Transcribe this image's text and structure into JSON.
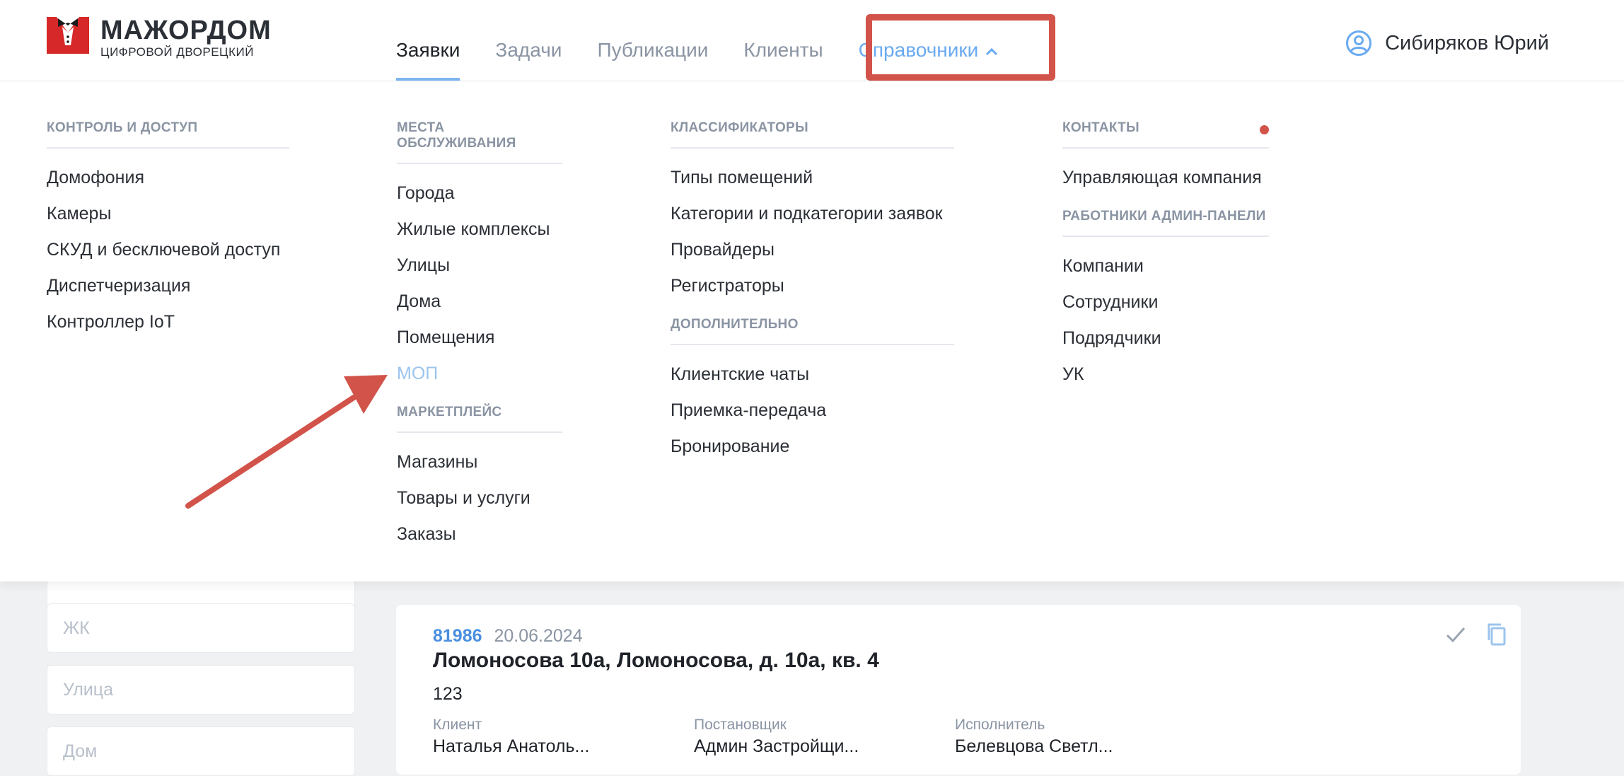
{
  "header": {
    "logo_title": "МАЖОРДОМ",
    "logo_subtitle": "ЦИФРОВОЙ ДВОРЕЦКИЙ",
    "nav": [
      {
        "label": "Заявки",
        "state": "active"
      },
      {
        "label": "Задачи",
        "state": "normal"
      },
      {
        "label": "Публикации",
        "state": "normal"
      },
      {
        "label": "Клиенты",
        "state": "normal"
      },
      {
        "label": "Справочники",
        "state": "open"
      }
    ],
    "user_name": "Сибиряков Юрий"
  },
  "dropdown": {
    "control": {
      "title": "КОНТРОЛЬ И ДОСТУП",
      "items": [
        "Домофония",
        "Камеры",
        "СКУД и бесключевой доступ",
        "Диспетчеризация",
        "Контроллер IoT"
      ]
    },
    "places": {
      "title": "МЕСТА ОБСЛУЖИВАНИЯ",
      "items": [
        "Города",
        "Жилые комплексы",
        "Улицы",
        "Дома",
        "Помещения",
        "МОП"
      ]
    },
    "marketplace": {
      "title": "МАРКЕТПЛЕЙС",
      "items": [
        "Магазины",
        "Товары и услуги",
        "Заказы"
      ]
    },
    "classifiers": {
      "title": "КЛАССИФИКАТОРЫ",
      "items": [
        "Типы помещений",
        "Категории и подкатегории заявок",
        "Провайдеры",
        "Регистраторы"
      ]
    },
    "additional": {
      "title": "ДОПОЛНИТЕЛЬНО",
      "items": [
        "Клиентские чаты",
        "Приемка-передача",
        "Бронирование"
      ]
    },
    "contacts": {
      "title": "КОНТАКТЫ",
      "items": [
        "Управляющая компания"
      ]
    },
    "admin_workers": {
      "title": "РАБОТНИКИ АДМИН-ПАНЕЛИ",
      "items": [
        "Компании",
        "Сотрудники",
        "Подрядчики",
        "УК"
      ]
    }
  },
  "filters": {
    "zhk_placeholder": "ЖК",
    "street_placeholder": "Улица",
    "house_placeholder": "Дом"
  },
  "card": {
    "id": "81986",
    "date": "20.06.2024",
    "title": "Ломоносова 10а, Ломоносова, д. 10а, кв. 4",
    "description": "123",
    "client_label": "Клиент",
    "client_value": "Наталья Анатоль...",
    "author_label": "Постановщик",
    "author_value": "Админ Застройщи...",
    "executor_label": "Исполнитель",
    "executor_value": "Белевцова Светл..."
  },
  "colors": {
    "accent": "#6aaaf0",
    "annotation": "#d2534a",
    "brand_red": "#d62828"
  }
}
